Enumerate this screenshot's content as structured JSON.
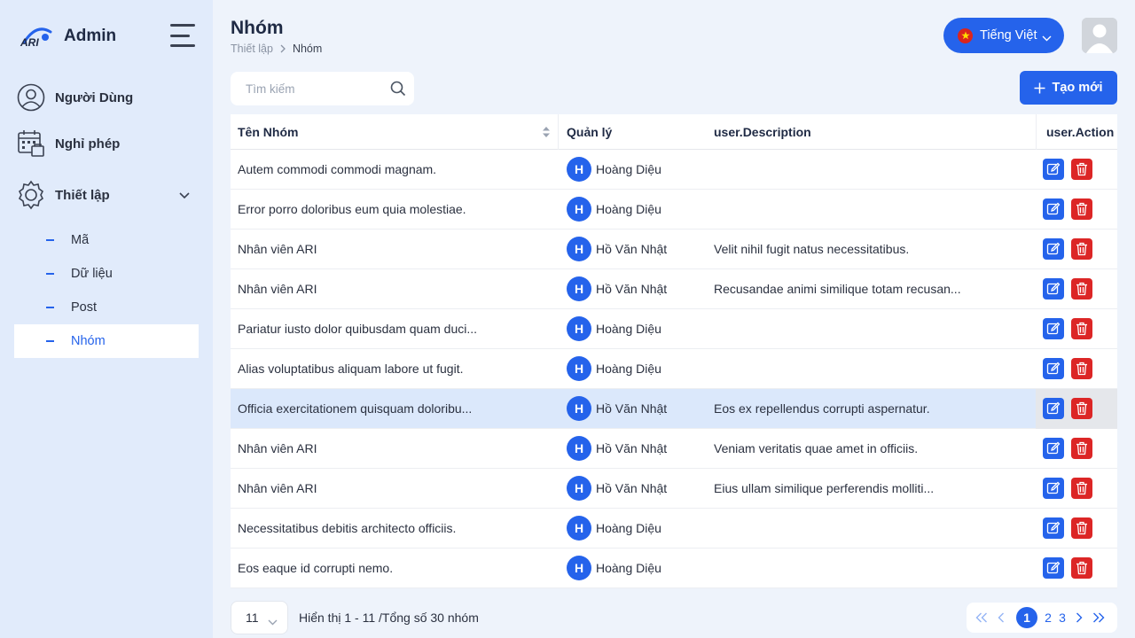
{
  "brand": {
    "name": "Admin"
  },
  "sidebar": {
    "items": [
      {
        "label": "Người Dùng",
        "icon": "user-circle-icon"
      },
      {
        "label": "Nghỉ phép",
        "icon": "calendar-icon"
      },
      {
        "label": "Thiết lập",
        "icon": "gear-icon",
        "expanded": true
      }
    ],
    "sub_items": [
      {
        "label": "Mã"
      },
      {
        "label": "Dữ liệu"
      },
      {
        "label": "Post"
      },
      {
        "label": "Nhóm",
        "active": true
      }
    ]
  },
  "header": {
    "title": "Nhóm",
    "breadcrumb": [
      "Thiết lập",
      "Nhóm"
    ],
    "language": "Tiếng Việt"
  },
  "toolbar": {
    "search_placeholder": "Tìm kiếm",
    "create_label": "Tạo mới"
  },
  "table": {
    "columns": [
      "Tên Nhóm",
      "Quản lý",
      "user.Description",
      "user.Action"
    ],
    "rows": [
      {
        "name": "Autem commodi commodi magnam.",
        "initial": "H",
        "manager": "Hoàng Diệu",
        "description": ""
      },
      {
        "name": "Error porro doloribus eum quia molestiae.",
        "initial": "H",
        "manager": "Hoàng Diệu",
        "description": ""
      },
      {
        "name": "Nhân viên ARI",
        "initial": "H",
        "manager": "Hồ Văn Nhật",
        "description": "Velit nihil fugit natus necessitatibus."
      },
      {
        "name": "Nhân viên ARI",
        "initial": "H",
        "manager": "Hồ Văn Nhật",
        "description": "Recusandae animi similique totam recusan..."
      },
      {
        "name": "Pariatur iusto dolor quibusdam quam duci...",
        "initial": "H",
        "manager": "Hoàng Diệu",
        "description": ""
      },
      {
        "name": "Alias voluptatibus aliquam labore ut fugit.",
        "initial": "H",
        "manager": "Hoàng Diệu",
        "description": ""
      },
      {
        "name": "Officia exercitationem quisquam doloribu...",
        "initial": "H",
        "manager": "Hồ Văn Nhật",
        "description": "Eos ex repellendus corrupti aspernatur.",
        "highlighted": true
      },
      {
        "name": "Nhân viên ARI",
        "initial": "H",
        "manager": "Hồ Văn Nhật",
        "description": "Veniam veritatis quae amet in officiis."
      },
      {
        "name": "Nhân viên ARI",
        "initial": "H",
        "manager": "Hồ Văn Nhật",
        "description": "Eius ullam similique perferendis molliti..."
      },
      {
        "name": "Necessitatibus debitis architecto officiis.",
        "initial": "H",
        "manager": "Hoàng Diệu",
        "description": ""
      },
      {
        "name": "Eos eaque id corrupti nemo.",
        "initial": "H",
        "manager": "Hoàng Diệu",
        "description": ""
      }
    ]
  },
  "footer": {
    "page_size": "11",
    "info": "Hiển thị 1 - 11 /Tổng số 30 nhóm",
    "pages": [
      "1",
      "2",
      "3"
    ],
    "current_page": "1"
  },
  "colors": {
    "accent": "#2563eb",
    "danger": "#dc2626",
    "sidebar_bg": "#e1ebfb",
    "page_bg": "#eef3fb"
  }
}
